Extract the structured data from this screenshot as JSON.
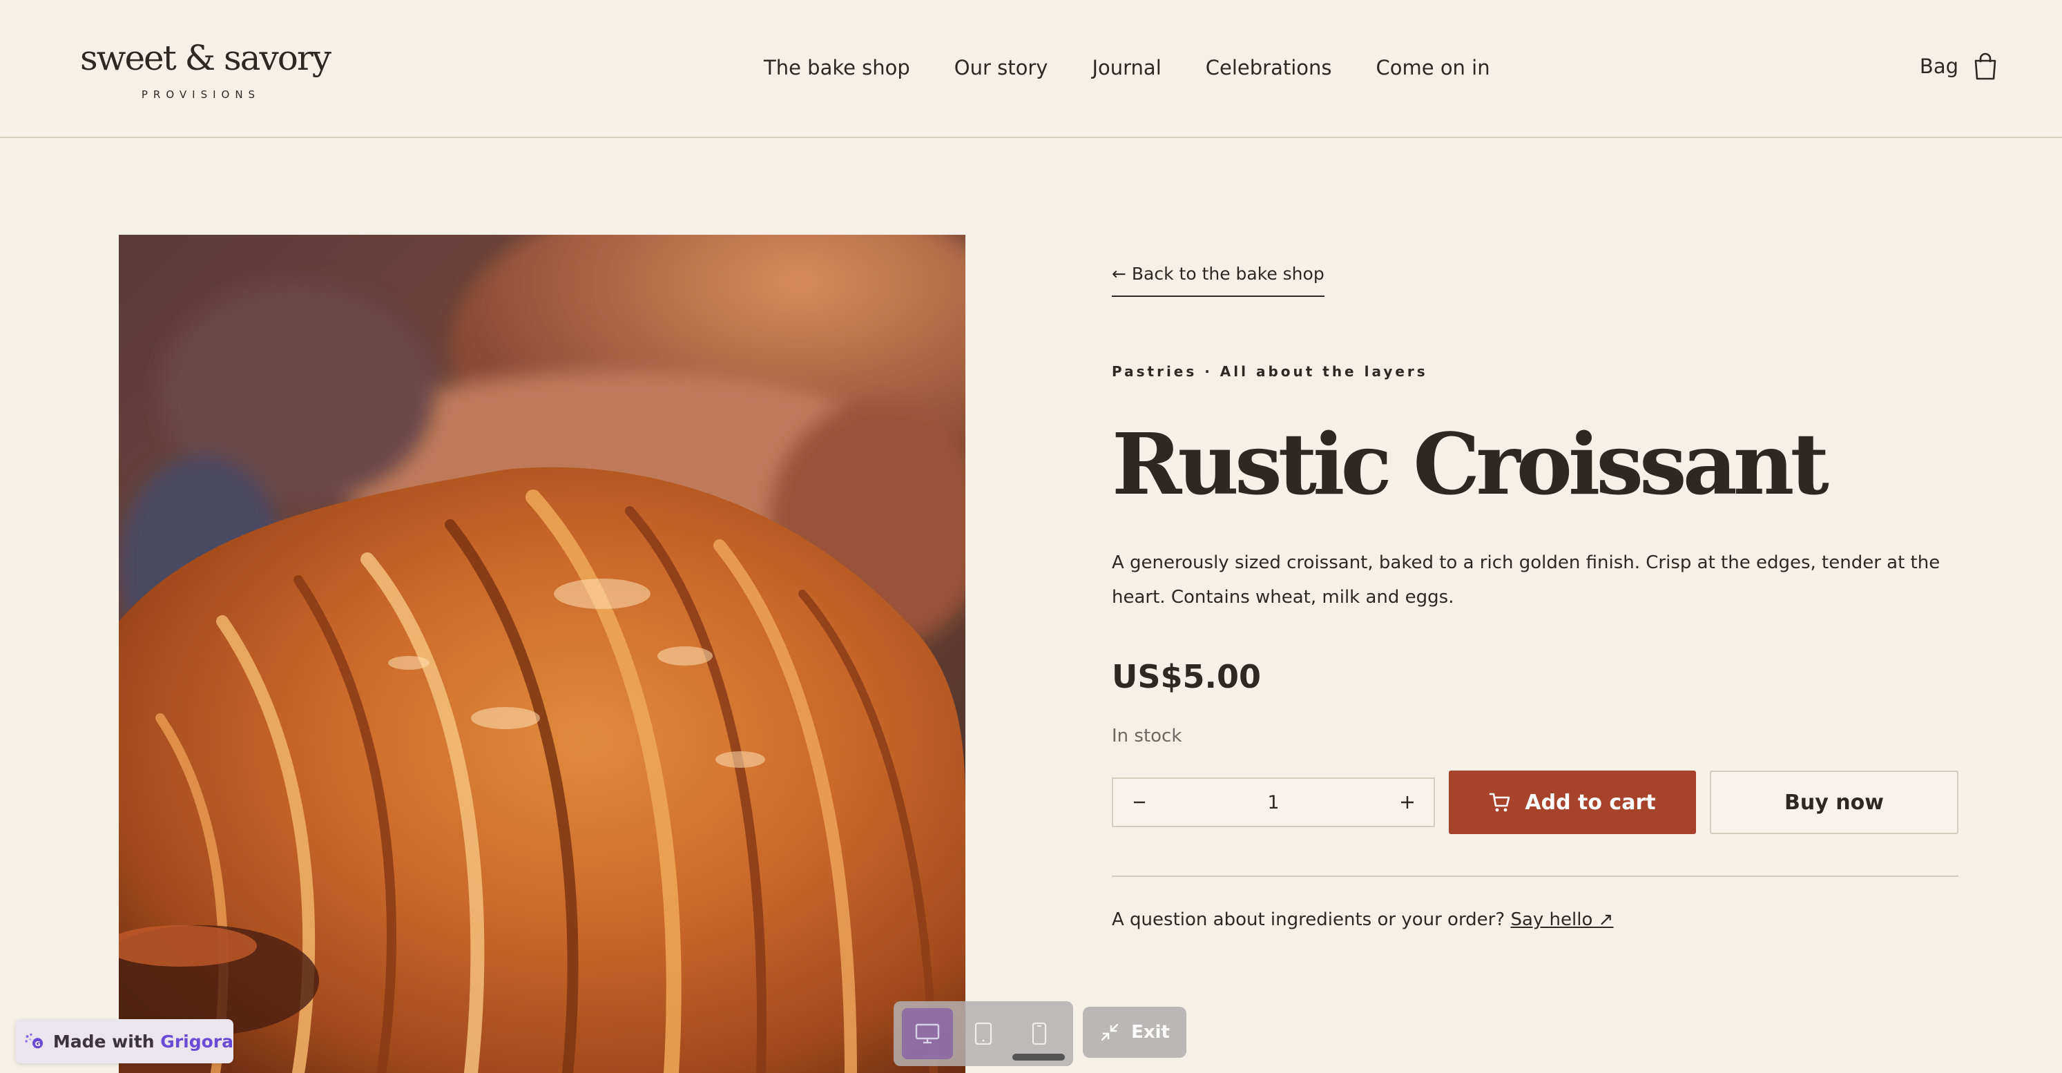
{
  "brand": {
    "name": "sweet & savory",
    "tagline": "PROVISIONS"
  },
  "nav": {
    "items": [
      "The bake shop",
      "Our story",
      "Journal",
      "Celebrations",
      "Come on in"
    ]
  },
  "header": {
    "bag_label": "Bag"
  },
  "product": {
    "back_link": "← Back to the bake shop",
    "breadcrumb": "Pastries · All about the layers",
    "title": "Rustic Croissant",
    "description": "A generously sized croissant, baked to a rich golden finish. Crisp at the edges, tender at the heart. Contains wheat, milk and eggs.",
    "price": "US$5.00",
    "stock": "In stock",
    "quantity": "1",
    "add_to_cart": "Add to cart",
    "buy_now": "Buy now",
    "contact_text": "A question about ingredients or your order?",
    "contact_link": "Say hello ↗"
  },
  "overlay": {
    "made_with": "Made with",
    "made_with_brand": "Grigora",
    "exit_label": "Exit"
  },
  "colors": {
    "background": "#f5f0e8",
    "accent": "#a8432b",
    "text": "#2e2824",
    "brand_purple": "#6b4ad6"
  },
  "icons": {
    "bag": "shopping-bag-icon",
    "cart": "cart-icon",
    "minus": "minus-icon",
    "plus": "plus-icon",
    "desktop": "desktop-icon",
    "tablet": "tablet-icon",
    "mobile": "mobile-icon",
    "exit": "collapse-icon"
  }
}
